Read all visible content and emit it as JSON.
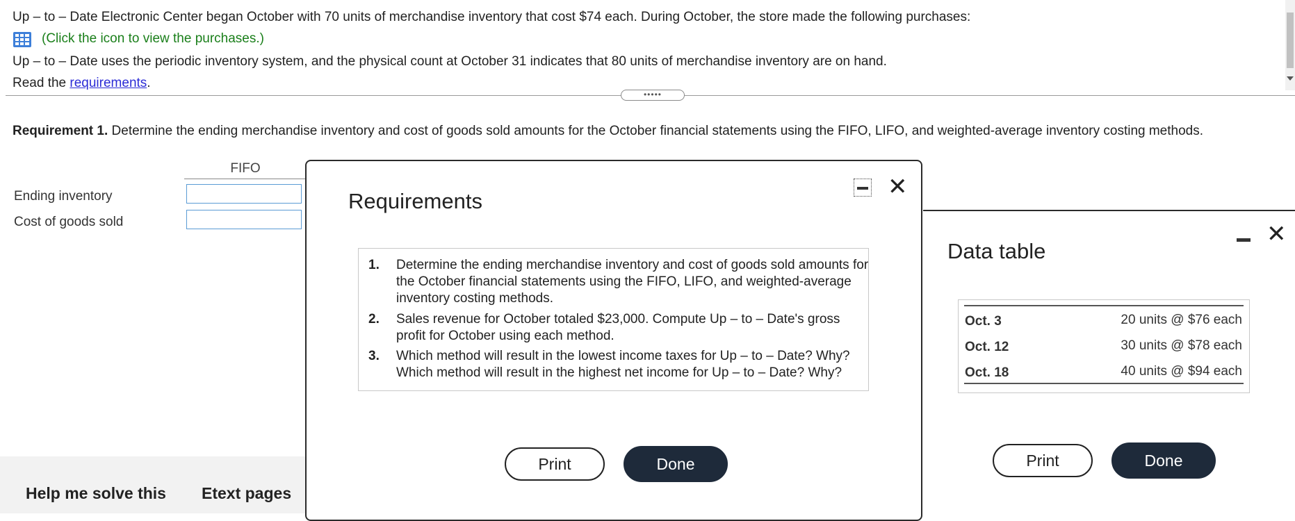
{
  "question": {
    "line1": "Up – to – Date Electronic Center began October with 70 units of merchandise inventory that cost $74 each. During October, the store made the following purchases:",
    "click_icon_text": "(Click the icon to view the purchases.)",
    "line3": "Up – to – Date uses the periodic inventory system, and the physical count at October 31 indicates that 80 units of merchandise inventory are on hand.",
    "read_prefix": "Read the ",
    "read_link": "requirements",
    "read_suffix": "."
  },
  "divider_grip": "•••••",
  "requirement1": {
    "label": "Requirement 1.",
    "text": " Determine the ending merchandise inventory and cost of goods sold amounts for the October financial statements using the FIFO, LIFO, and weighted-average inventory costing methods."
  },
  "answer_table": {
    "column_header": "FIFO",
    "rows": [
      {
        "label": "Ending inventory",
        "value": ""
      },
      {
        "label": "Cost of goods sold",
        "value": ""
      }
    ]
  },
  "footer": {
    "help_button": "Help me solve this",
    "etext_button": "Etext pages"
  },
  "requirements_modal": {
    "title": "Requirements",
    "items": [
      {
        "num": "1.",
        "text": "Determine the ending merchandise inventory and cost of goods sold amounts for the October financial statements using the FIFO, LIFO, and weighted-average inventory costing methods."
      },
      {
        "num": "2.",
        "text": "Sales revenue for October totaled $23,000. Compute Up – to – Date's gross profit for October using each method."
      },
      {
        "num": "3.",
        "text": "Which method will result in the lowest income taxes for Up – to – Date? Why? Which method will result in the highest net income for Up – to – Date? Why?"
      }
    ],
    "print_label": "Print",
    "done_label": "Done"
  },
  "data_table_modal": {
    "title": "Data table",
    "rows": [
      {
        "date": "Oct. 3",
        "value": "20 units @ $76 each"
      },
      {
        "date": "Oct. 12",
        "value": "30 units @ $78 each"
      },
      {
        "date": "Oct. 18",
        "value": "40 units @ $94 each"
      }
    ],
    "print_label": "Print",
    "done_label": "Done"
  },
  "colors": {
    "link": "#2b2bd6",
    "green_text": "#1a7f1a",
    "dark_button": "#1e2a3a",
    "input_border": "#5a9bd5"
  }
}
